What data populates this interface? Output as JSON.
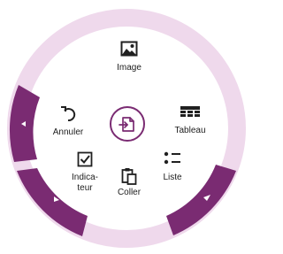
{
  "menu": {
    "items": {
      "image": {
        "label": "Image",
        "icon": "image-icon"
      },
      "tableau": {
        "label": "Tableau",
        "icon": "table-icon"
      },
      "liste": {
        "label": "Liste",
        "icon": "bullet-list-icon"
      },
      "coller": {
        "label": "Coller",
        "icon": "paste-icon"
      },
      "indicateur_line1": {
        "label": "Indica-",
        "icon": "checkbox-icon"
      },
      "indicateur_line2": {
        "label": "teur"
      },
      "annuler": {
        "label": "Annuler",
        "icon": "undo-icon"
      }
    },
    "center": {
      "icon": "insert-icon"
    }
  },
  "colors": {
    "ring_light": "#efd9ec",
    "ring_dark": "#7a2b72",
    "accent": "#7a2b72",
    "text": "#202020"
  }
}
